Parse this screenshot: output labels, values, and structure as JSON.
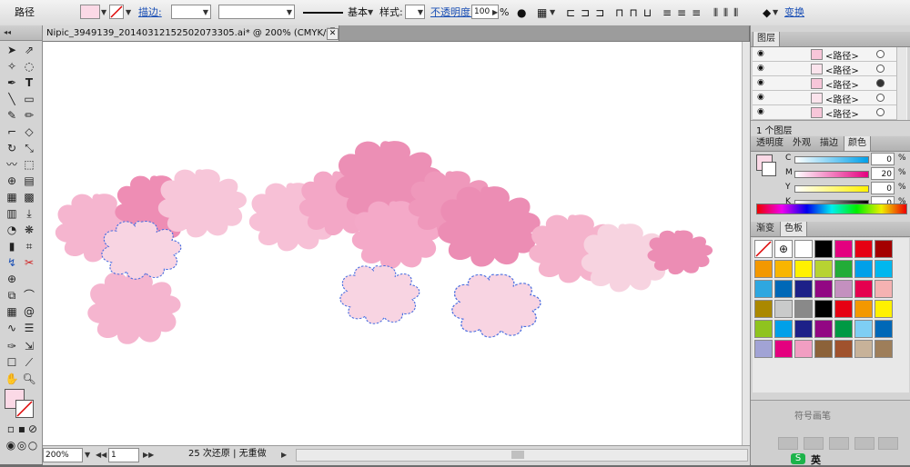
{
  "control_bar": {
    "object_type": "路径",
    "stroke_label": "描边:",
    "stroke_style_name": "基本",
    "style_label": "样式:",
    "opacity_label": "不透明度:",
    "opacity_value": "100",
    "opacity_unit": "%",
    "transform_label": "变换"
  },
  "document": {
    "tab_title": "Nipic_3949139_20140312152502073305.ai* @ 200% (CMYK/预览)",
    "close_glyph": "✕"
  },
  "status_bar": {
    "zoom": "200%",
    "page": "1",
    "undo_text": "25 次还原 | 无重做"
  },
  "layers_panel": {
    "title": "图层",
    "rows": [
      {
        "name": "<路径>",
        "target_filled": false
      },
      {
        "name": "<路径>",
        "target_filled": false
      },
      {
        "name": "<路径>",
        "target_filled": true
      },
      {
        "name": "<路径>",
        "target_filled": false
      },
      {
        "name": "<路径>",
        "target_filled": false
      }
    ],
    "footer": "1 个图层"
  },
  "color_panel": {
    "tabs": [
      "透明度",
      "外观",
      "描边",
      "颜色"
    ],
    "active_tab": "颜色",
    "channels": [
      {
        "key": "C",
        "value": "0",
        "color": "#00a0e9"
      },
      {
        "key": "M",
        "value": "20",
        "color": "#e4007f"
      },
      {
        "key": "Y",
        "value": "0",
        "color": "#fff100"
      },
      {
        "key": "K",
        "value": "0",
        "color": "#000000"
      }
    ],
    "percent": "%",
    "fill_color": "#fbd9e6"
  },
  "swatches_panel": {
    "tabs": [
      "渐变",
      "色板"
    ],
    "active_tab": "色板",
    "colors": [
      "#ffffff",
      "#000000",
      "#e4007f",
      "#e60012",
      "#a40000",
      "#f39800",
      "#f8b500",
      "#fff100",
      "#b7d332",
      "#22ac38",
      "#00a0e9",
      "#00b7ee",
      "#2ea7e0",
      "#0068b7",
      "#1d2088",
      "#920783",
      "#c490bf",
      "#e5004f",
      "#f5b2b2",
      "#aa8800",
      "#c9caca",
      "#898989",
      "#000000",
      "#e60012",
      "#f39800",
      "#fff100",
      "#8fc31f",
      "#00a0e9",
      "#1d2088",
      "#920783",
      "#009944",
      "#7ecef4",
      "#0068b7",
      "#a1a3d5",
      "#e4007f",
      "#f19ec2",
      "#8c6239",
      "#a0522d",
      "#c7b299",
      "#9e7e5a"
    ]
  },
  "brush_panel": {
    "label": "符号画笔"
  },
  "toolbar": {
    "fill_color": "#fbd9e6"
  },
  "ime": {
    "lang": "英"
  }
}
